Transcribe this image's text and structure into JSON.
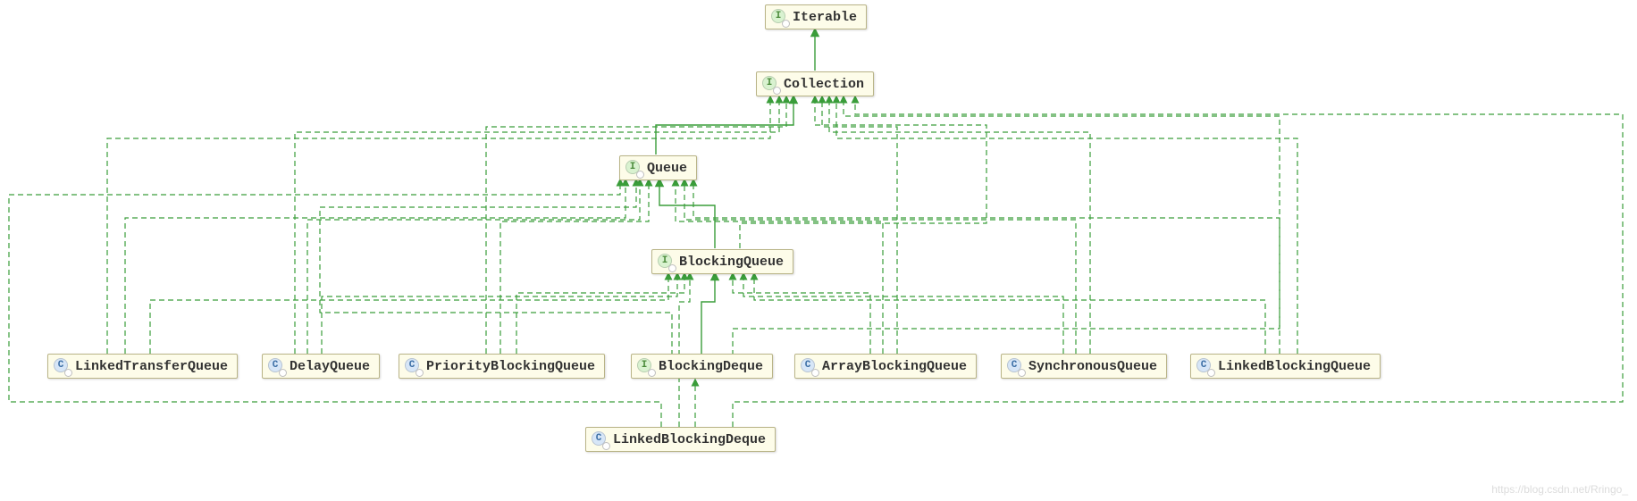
{
  "nodes": {
    "iterable": {
      "label": "Iterable",
      "type": "interface"
    },
    "collection": {
      "label": "Collection",
      "type": "interface"
    },
    "queue": {
      "label": "Queue",
      "type": "interface"
    },
    "blockingqueue": {
      "label": "BlockingQueue",
      "type": "interface"
    },
    "linkedtransfer": {
      "label": "LinkedTransferQueue",
      "type": "class"
    },
    "delayqueue": {
      "label": "DelayQueue",
      "type": "class"
    },
    "priorityblocking": {
      "label": "PriorityBlockingQueue",
      "type": "class"
    },
    "blockingdeque": {
      "label": "BlockingDeque",
      "type": "interface"
    },
    "arrayblocking": {
      "label": "ArrayBlockingQueue",
      "type": "class"
    },
    "synchronous": {
      "label": "SynchronousQueue",
      "type": "class"
    },
    "linkedblockingqueue": {
      "label": "LinkedBlockingQueue",
      "type": "class"
    },
    "linkedblockingdeque": {
      "label": "LinkedBlockingDeque",
      "type": "class"
    }
  },
  "icon_glyph": {
    "interface": "I",
    "class": "C"
  },
  "watermark": "https://blog.csdn.net/Rringo_"
}
